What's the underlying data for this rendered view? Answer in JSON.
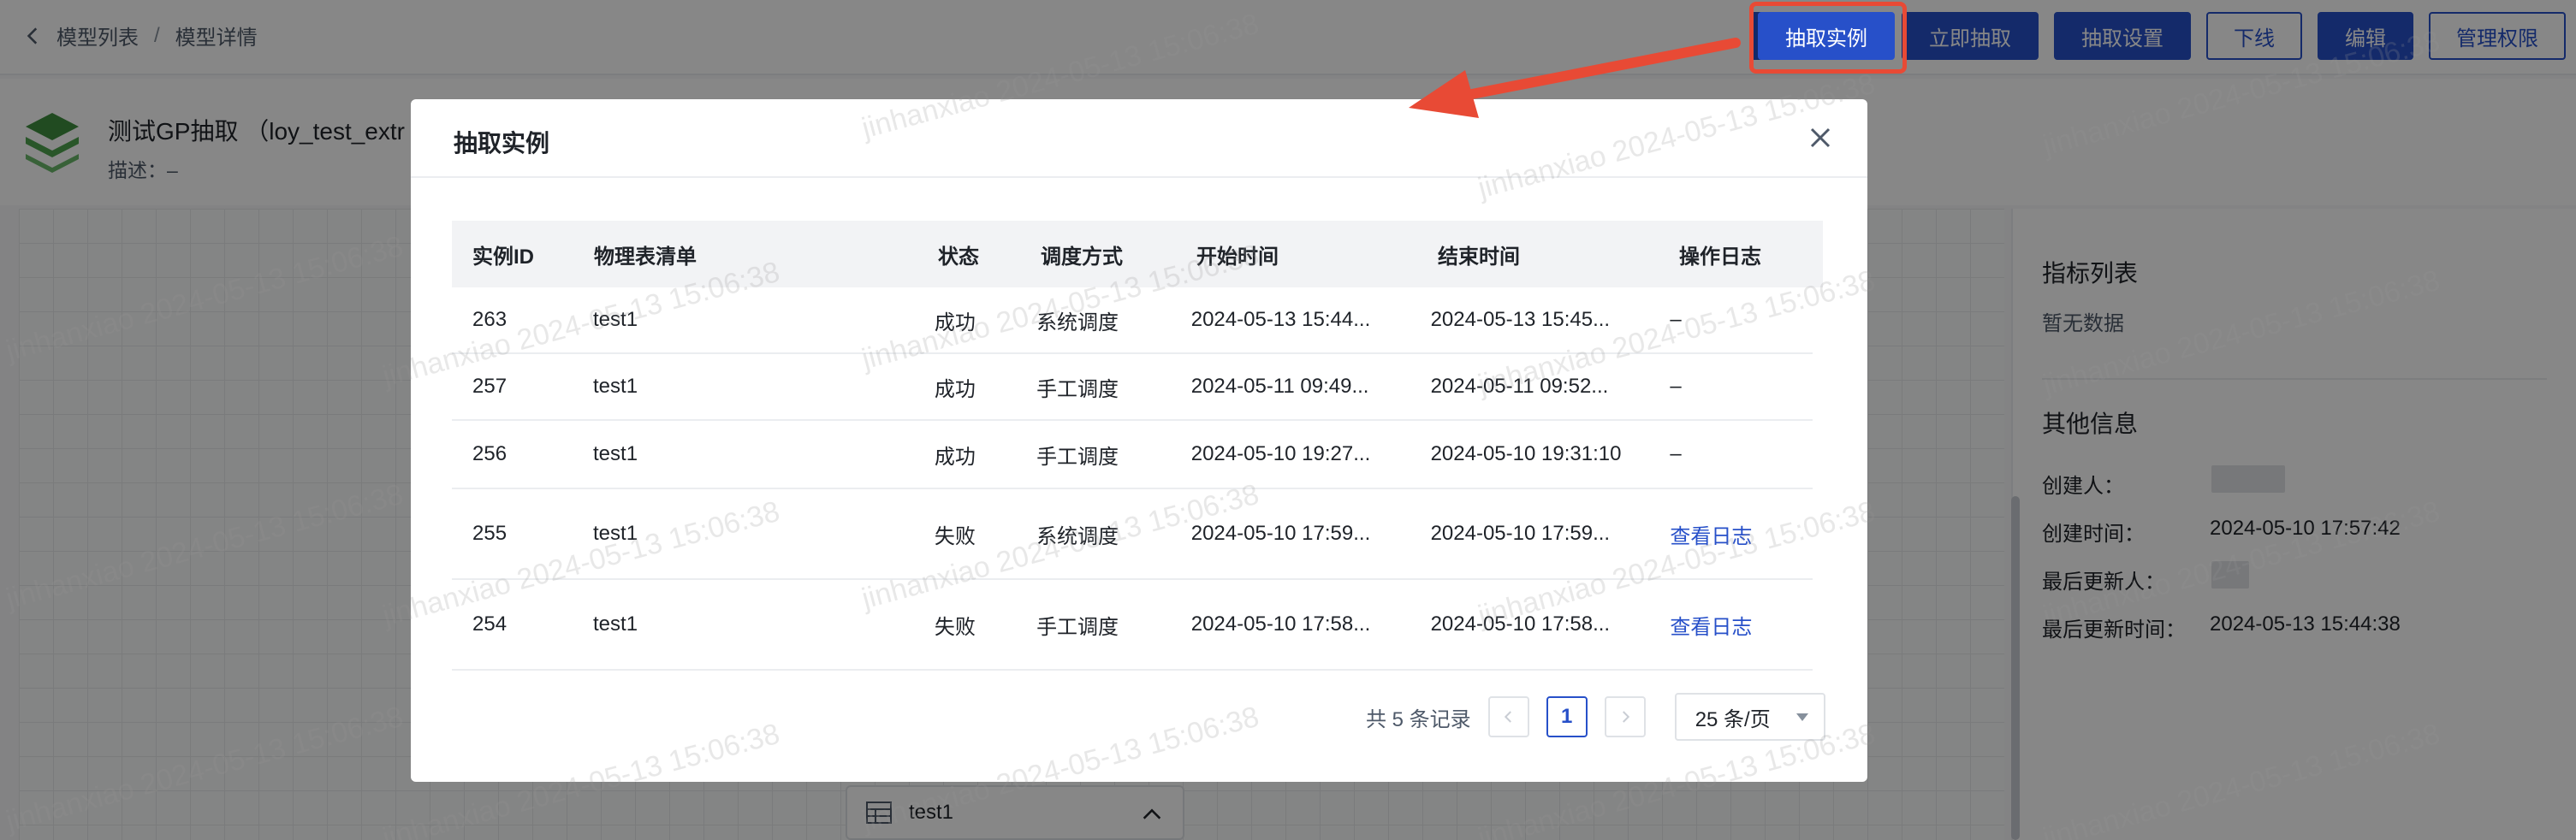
{
  "breadcrumb": {
    "parent": "模型列表",
    "separator": "/",
    "current": "模型详情"
  },
  "toolbar": {
    "buttons": [
      "抽取实例",
      "立即抽取",
      "抽取设置",
      "下线",
      "编辑",
      "管理权限"
    ]
  },
  "model": {
    "title": "测试GP抽取 （loy_test_extr",
    "description": "描述：–"
  },
  "canvas": {
    "node_label": "test1"
  },
  "right_panel": {
    "metrics_title": "指标列表",
    "metrics_empty": "暂无数据",
    "other_title": "其他信息",
    "creator_label": "创建人：",
    "created_time_label": "创建时间：",
    "created_time": "2024-05-10 17:57:42",
    "updater_label": "最后更新人：",
    "updated_time_label": "最后更新时间：",
    "updated_time": "2024-05-13 15:44:38"
  },
  "modal": {
    "title": "抽取实例",
    "columns": [
      "实例ID",
      "物理表清单",
      "状态",
      "调度方式",
      "开始时间",
      "结束时间",
      "操作日志"
    ],
    "rows": [
      [
        "263",
        "test1",
        "成功",
        "系统调度",
        "2024-05-13 15:44...",
        "2024-05-13 15:45...",
        "–"
      ],
      [
        "257",
        "test1",
        "成功",
        "手工调度",
        "2024-05-11 09:49...",
        "2024-05-11 09:52...",
        "–"
      ],
      [
        "256",
        "test1",
        "成功",
        "手工调度",
        "2024-05-10 19:27...",
        "2024-05-10 19:31:10",
        "–"
      ],
      [
        "255",
        "test1",
        "失败",
        "系统调度",
        "2024-05-10 17:59...",
        "2024-05-10 17:59...",
        "查看日志"
      ],
      [
        "254",
        "test1",
        "失败",
        "手工调度",
        "2024-05-10 17:58...",
        "2024-05-10 17:58...",
        "查看日志"
      ]
    ],
    "pagination": {
      "total_text": "共 5 条记录",
      "current_page": "1",
      "page_size": "25 条/页"
    }
  },
  "watermark": "jinhanxiao 2024-05-13 15:06:38",
  "colors": {
    "primary": "#2750c9",
    "annotation": "#e84a35",
    "logo": "#3f8f3f"
  }
}
